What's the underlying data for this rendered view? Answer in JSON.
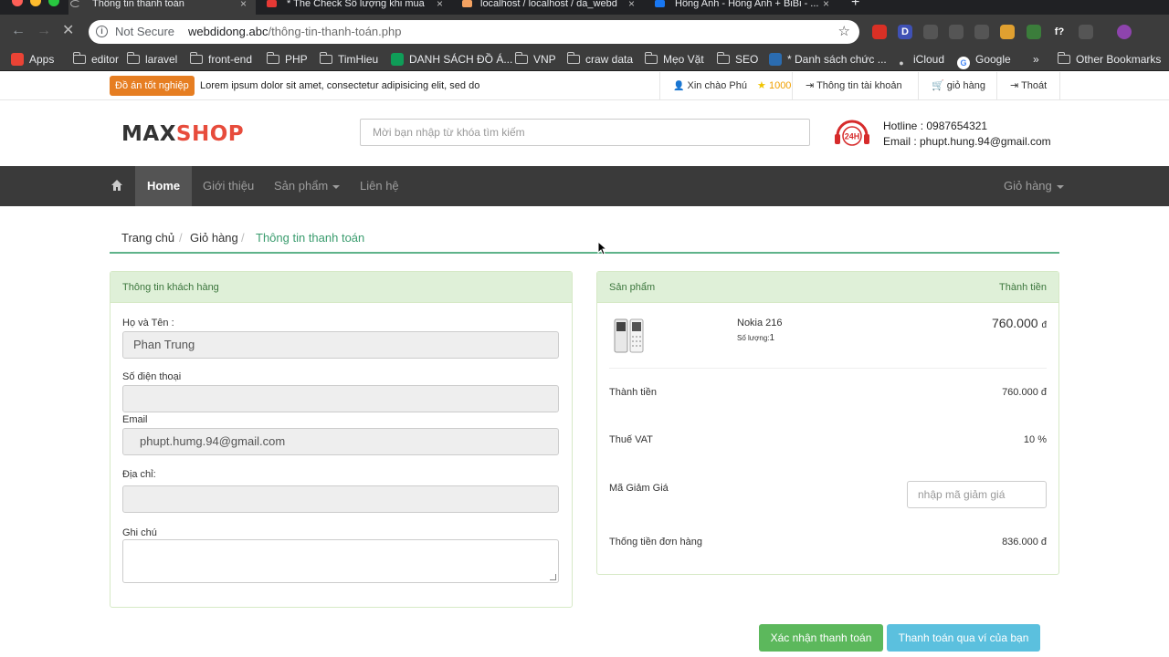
{
  "browser": {
    "tabs": [
      {
        "title": "Thông tin thanh toán",
        "active": true,
        "icon": "loading-icon",
        "color": "#5f6368"
      },
      {
        "title": "* The Check Số lượng khi mua",
        "active": false,
        "icon": "stackedit-icon",
        "color": "#e53935"
      },
      {
        "title": "localhost / localhost / da_webd",
        "active": false,
        "icon": "phpmyadmin-icon",
        "color": "#f4a261"
      },
      {
        "title": "Hồng Anh - Hồng Anh + BiBi - ...",
        "active": false,
        "icon": "facebook-icon",
        "color": "#1877f2"
      }
    ],
    "new_tab": "+",
    "omnibox": {
      "security": "Not Secure",
      "url_domain": "webdidong.abc",
      "url_path": "/thông-tin-thanh-toán.php"
    },
    "extensions": [
      {
        "icon": "extension-red-icon",
        "label": "",
        "color": "#d93025"
      },
      {
        "icon": "extension-d-icon",
        "label": "D",
        "color": "#3f51b5"
      },
      {
        "icon": "camera-icon",
        "label": "",
        "color": "#555"
      },
      {
        "icon": "recycle-icon",
        "label": "",
        "color": "#555"
      },
      {
        "icon": "gear-icon",
        "label": "",
        "color": "#555"
      },
      {
        "icon": "translate-icon",
        "label": "",
        "color": "#e0a030"
      },
      {
        "icon": "chart-icon",
        "label": "",
        "color": "#3b7d3b"
      },
      {
        "icon": "fx-icon",
        "label": "f?",
        "color": "#3c3c3c"
      },
      {
        "icon": "clock-icon",
        "label": "",
        "color": "#555"
      },
      {
        "icon": "profile-avatar-icon",
        "label": "",
        "color": "#8e44ad"
      }
    ],
    "bookmarks": [
      {
        "label": "Apps",
        "icon": "apps-grid-icon"
      },
      {
        "label": "editor",
        "icon": "folder-icon"
      },
      {
        "label": "laravel",
        "icon": "folder-icon"
      },
      {
        "label": "front-end",
        "icon": "folder-icon"
      },
      {
        "label": "PHP",
        "icon": "folder-icon"
      },
      {
        "label": "TimHieu",
        "icon": "folder-icon"
      },
      {
        "label": "DANH SÁCH ĐỒ Á...",
        "icon": "sheets-icon"
      },
      {
        "label": "VNP",
        "icon": "folder-icon"
      },
      {
        "label": "craw data",
        "icon": "folder-icon"
      },
      {
        "label": "Mẹo Vặt",
        "icon": "folder-icon"
      },
      {
        "label": "SEO",
        "icon": "folder-icon"
      },
      {
        "label": "* Danh sách chức ...",
        "icon": "stackedit-icon"
      },
      {
        "label": "iCloud",
        "icon": "apple-icon"
      },
      {
        "label": "Google",
        "icon": "google-icon"
      }
    ],
    "overflow": "»",
    "other_bookmarks": "Other Bookmarks"
  },
  "topbar": {
    "badge": "Đồ án tốt nghiệp",
    "marquee": "Lorem ipsum dolor sit amet, consectetur adipisicing elit, sed do",
    "greeting": "Xin chào Phú",
    "points": "1000",
    "account": "Thông tin tài khoản",
    "cart": "giỏ hàng",
    "logout": "Thoát"
  },
  "header": {
    "logo_max": "MAX",
    "logo_shop": "SHOP",
    "search_placeholder": "Mời bạn nhập từ khóa tìm kiếm",
    "support_badge": "24H",
    "hotline": "Hotline : 0987654321",
    "email": "Email : phupt.hung.94@gmail.com"
  },
  "nav": {
    "items": [
      "Home",
      "Giới thiệu",
      "Sản phẩm",
      "Liên hệ"
    ],
    "cart": "Giỏ hàng"
  },
  "breadcrumb": [
    "Trang chủ",
    "Giỏ hàng",
    "Thông tin thanh toán"
  ],
  "customer": {
    "heading": "Thông tin khách hàng",
    "fields": {
      "name_label": "Họ và Tên :",
      "name_value": "Phan Trung",
      "phone_label": "Số điện thoại",
      "phone_value": "",
      "email_label": "Email",
      "email_value": "phupt.humg.94@gmail.com",
      "address_label": "Địa chỉ:",
      "address_value": "",
      "note_label": "Ghi chú"
    }
  },
  "order": {
    "col_product": "Sản phẩm",
    "col_total": "Thành tiền",
    "product_name": "Nokia 216",
    "qty_label": "Số lượng:",
    "qty_value": "1",
    "product_price": "760.000",
    "currency": "đ",
    "subtotal_label": "Thành tiền",
    "subtotal_value": "760.000 đ",
    "vat_label": "Thuế VAT",
    "vat_value": "10 %",
    "coupon_label": "Mã Giảm Giá",
    "coupon_placeholder": "nhập mã giảm giá",
    "total_label": "Thống tiền đơn hàng",
    "total_value": "836.000 đ"
  },
  "actions": {
    "confirm": "Xác nhận thanh toán",
    "wallet": "Thanh toán qua ví của bạn"
  },
  "colors": {
    "accent_green": "#5cb85c",
    "info_blue": "#5bc0de",
    "brand_red": "#e74c3c",
    "badge_orange": "#e67e22"
  }
}
